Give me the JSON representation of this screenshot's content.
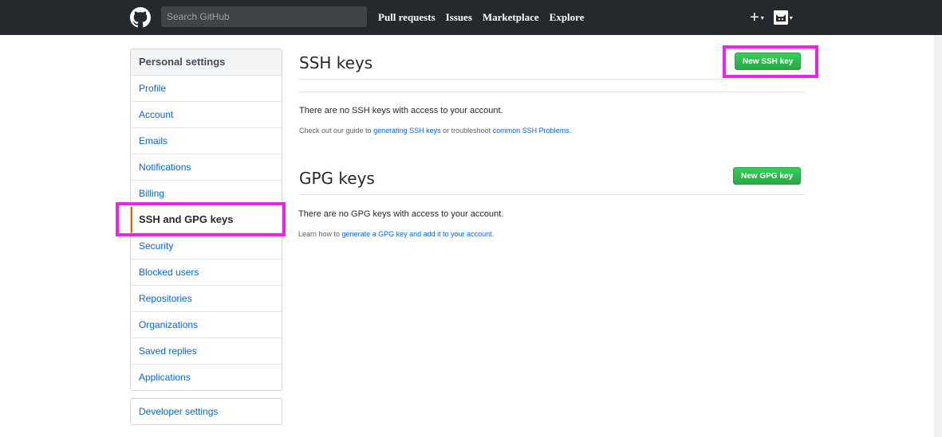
{
  "header": {
    "search_placeholder": "Search GitHub",
    "nav": [
      "Pull requests",
      "Issues",
      "Marketplace",
      "Explore"
    ],
    "plus_label": "+",
    "caret": "▾",
    "icons": {
      "logo": "github-logo-icon",
      "plus": "plus-icon",
      "avatar": "avatar"
    }
  },
  "sidebar": {
    "heading": "Personal settings",
    "items": [
      {
        "label": "Profile"
      },
      {
        "label": "Account"
      },
      {
        "label": "Emails"
      },
      {
        "label": "Notifications"
      },
      {
        "label": "Billing"
      },
      {
        "label": "SSH and GPG keys",
        "selected": true
      },
      {
        "label": "Security"
      },
      {
        "label": "Blocked users"
      },
      {
        "label": "Repositories"
      },
      {
        "label": "Organizations"
      },
      {
        "label": "Saved replies"
      },
      {
        "label": "Applications"
      }
    ],
    "developer_settings": "Developer settings"
  },
  "ssh": {
    "title": "SSH keys",
    "button": "New SSH key",
    "empty_text": "There are no SSH keys with access to your account.",
    "guide_prefix": "Check out our guide to ",
    "guide_link": "generating SSH keys",
    "guide_middle": " or troubleshoot ",
    "guide_link2": "common SSH Problems",
    "guide_suffix": "."
  },
  "gpg": {
    "title": "GPG keys",
    "button": "New GPG key",
    "empty_text": "There are no GPG keys with access to your account.",
    "learn_prefix": "Learn how to ",
    "learn_link": "generate a GPG key and add it to your account",
    "learn_suffix": "."
  },
  "colors": {
    "header_bg": "#24292e",
    "link": "#0366d6",
    "green": "#28a745",
    "highlight": "#ee22ee",
    "selected_border": "#e36209"
  }
}
